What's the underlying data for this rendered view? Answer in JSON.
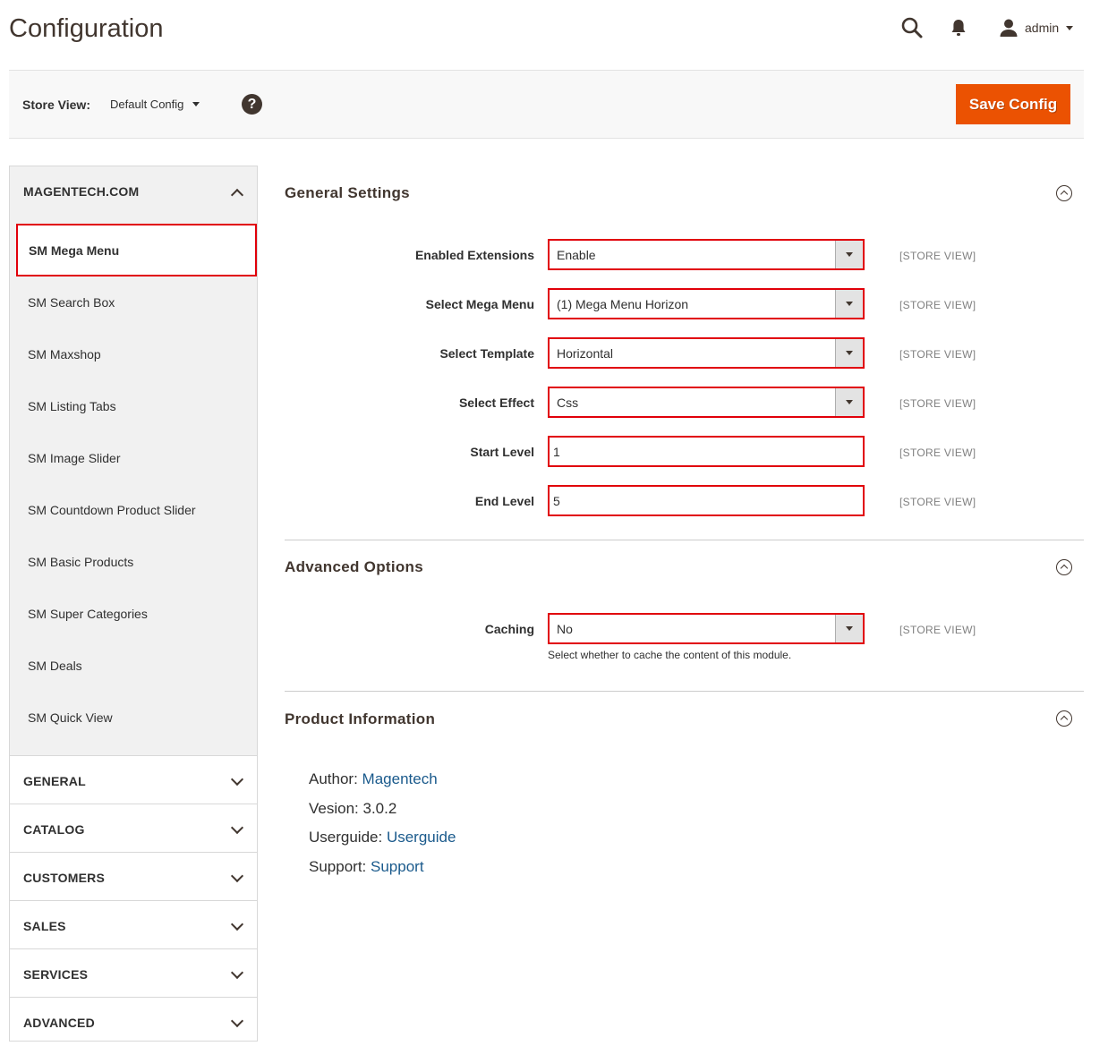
{
  "header": {
    "title": "Configuration",
    "user_name": "admin"
  },
  "store_bar": {
    "label": "Store View:",
    "selected": "Default Config",
    "help": "?",
    "save_label": "Save Config"
  },
  "sidebar": {
    "open_group": {
      "label": "MAGENTECH.COM",
      "items": [
        {
          "label": "SM Mega Menu",
          "active": true
        },
        {
          "label": "SM Search Box"
        },
        {
          "label": "SM Maxshop"
        },
        {
          "label": "SM Listing Tabs"
        },
        {
          "label": "SM Image Slider"
        },
        {
          "label": "SM Countdown Product Slider"
        },
        {
          "label": "SM Basic Products"
        },
        {
          "label": "SM Super Categories"
        },
        {
          "label": "SM Deals"
        },
        {
          "label": "SM Quick View"
        }
      ]
    },
    "groups": [
      {
        "label": "GENERAL"
      },
      {
        "label": "CATALOG"
      },
      {
        "label": "CUSTOMERS"
      },
      {
        "label": "SALES"
      },
      {
        "label": "SERVICES"
      },
      {
        "label": "ADVANCED"
      }
    ]
  },
  "general_settings": {
    "title": "General Settings",
    "fields": [
      {
        "label": "Enabled Extensions",
        "value": "Enable",
        "scope": "[STORE VIEW]"
      },
      {
        "label": "Select Mega Menu",
        "value": "(1) Mega Menu Horizon",
        "scope": "[STORE VIEW]"
      },
      {
        "label": "Select Template",
        "value": "Horizontal",
        "scope": "[STORE VIEW]"
      },
      {
        "label": "Select Effect",
        "value": "Css",
        "scope": "[STORE VIEW]"
      },
      {
        "label": "Start Level",
        "value": "1",
        "scope": "[STORE VIEW]"
      },
      {
        "label": "End Level",
        "value": "5",
        "scope": "[STORE VIEW]"
      }
    ]
  },
  "advanced_options": {
    "title": "Advanced Options",
    "caching": {
      "label": "Caching",
      "value": "No",
      "scope": "[STORE VIEW]",
      "note": "Select whether to cache the content of this module."
    }
  },
  "product_information": {
    "title": "Product Information",
    "author_label": "Author:",
    "author_value": "Magentech",
    "version_label": "Vesion:",
    "version_value": "3.0.2",
    "userguide_label": "Userguide:",
    "userguide_value": "Userguide",
    "support_label": "Support:",
    "support_value": "Support"
  },
  "colors": {
    "accent": "#eb5202",
    "highlight_border": "#e1000a",
    "link": "#1a5a8c"
  }
}
